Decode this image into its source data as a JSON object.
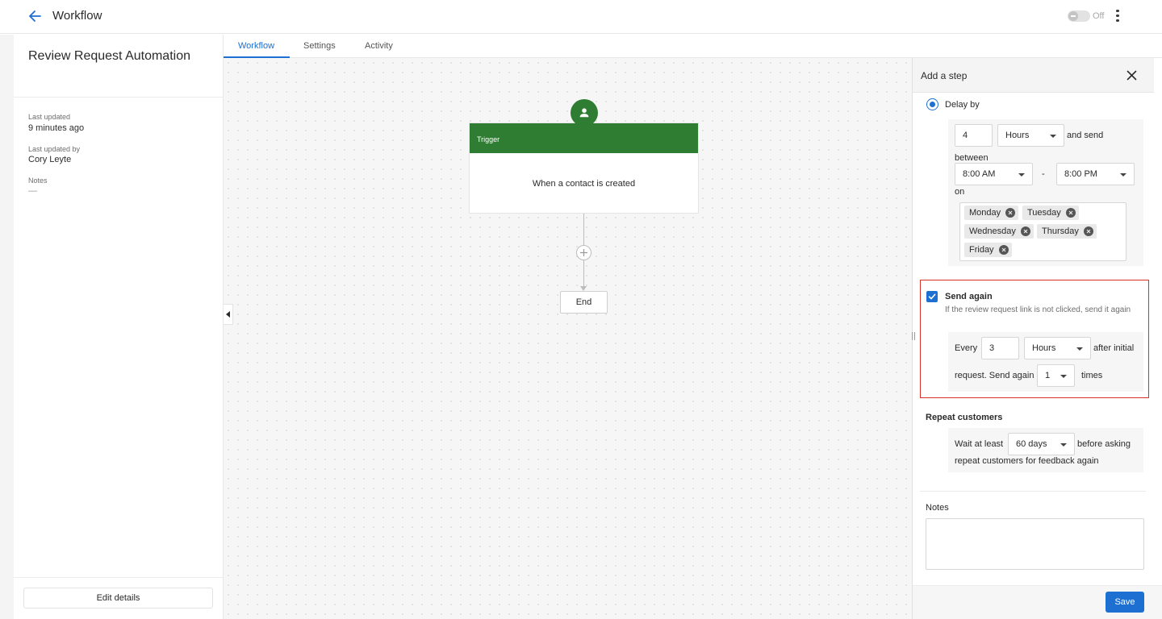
{
  "header": {
    "title": "Workflow",
    "toggle_label": "Off",
    "toggle_state": "off"
  },
  "left_panel": {
    "title": "Review Request Automation",
    "last_updated_label": "Last updated",
    "last_updated_value": "9 minutes ago",
    "last_updated_by_label": "Last updated by",
    "last_updated_by_value": "Cory Leyte",
    "notes_label": "Notes",
    "notes_value": "—",
    "edit_button": "Edit details"
  },
  "tabs": [
    {
      "label": "Workflow",
      "active": true
    },
    {
      "label": "Settings",
      "active": false
    },
    {
      "label": "Activity",
      "active": false
    }
  ],
  "canvas": {
    "trigger_label": "Trigger",
    "trigger_text": "When a contact is created",
    "end_label": "End"
  },
  "step_panel": {
    "title": "Add a step",
    "delay": {
      "option_label": "Delay by",
      "selected": true,
      "amount": "4",
      "unit": "Hours",
      "and_send": "and send",
      "between": "between",
      "start_time": "8:00 AM",
      "dash": "-",
      "end_time": "8:00 PM",
      "on": "on",
      "days": [
        "Monday",
        "Tuesday",
        "Wednesday",
        "Thursday",
        "Friday"
      ]
    },
    "send_again": {
      "checked": true,
      "label": "Send again",
      "description": "If the review request link is not clicked, send it again",
      "every": "Every",
      "interval": "3",
      "unit": "Hours",
      "after_initial": "after initial",
      "request_send_again": "request. Send again",
      "times_value": "1",
      "times": "times"
    },
    "repeat": {
      "heading": "Repeat customers",
      "wait_at_least": "Wait at least",
      "period": "60 days",
      "before_asking": "before asking",
      "tail": "repeat customers for feedback again"
    },
    "notes_label": "Notes",
    "save_button": "Save"
  },
  "colors": {
    "accent": "#1d6fd1",
    "trigger_green": "#2e7d32",
    "highlight_red": "#d93025"
  },
  "icons": {
    "back": "arrow-left-icon",
    "more": "more-vertical-icon",
    "trigger_avatar": "person-icon",
    "add": "plus-icon",
    "close": "close-icon",
    "chip_remove": "close-circle-icon",
    "collapse": "caret-left-icon"
  }
}
